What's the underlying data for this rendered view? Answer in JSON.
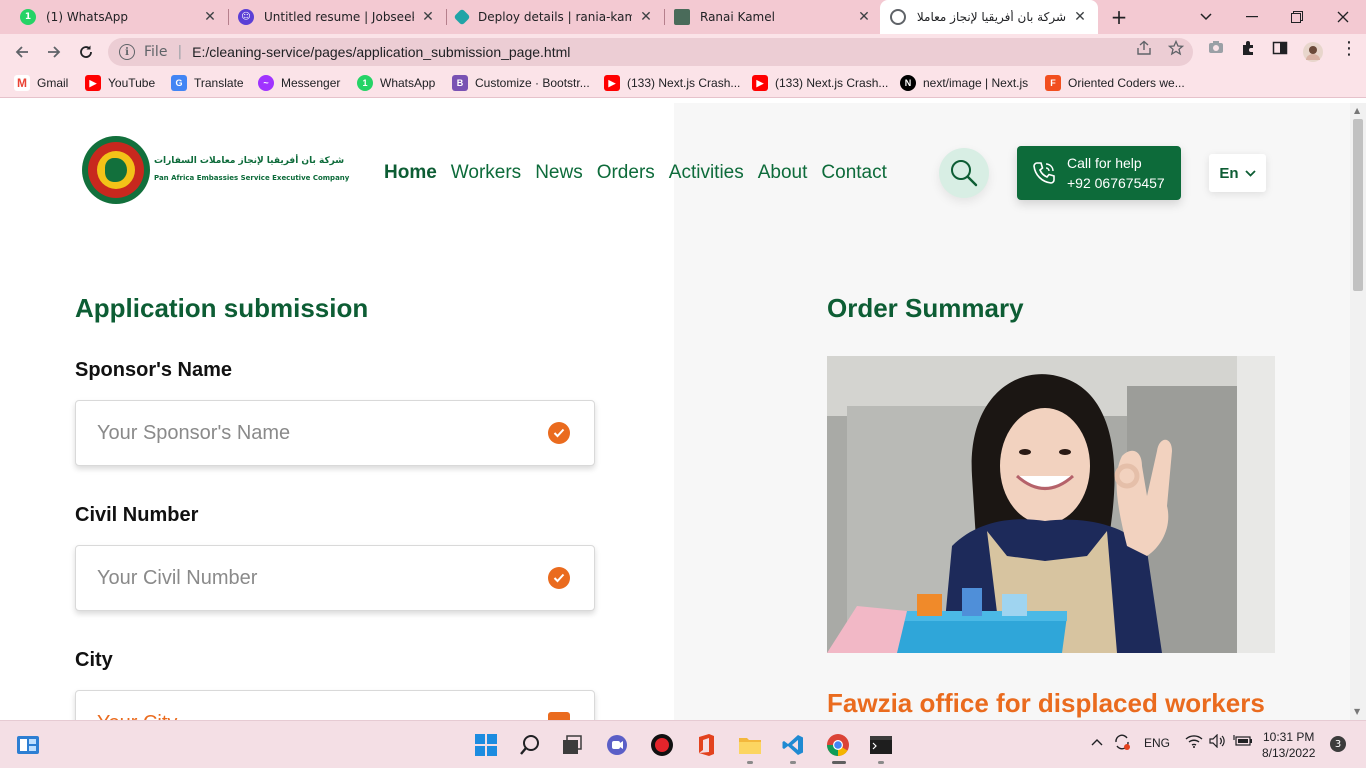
{
  "browser": {
    "tabs": [
      {
        "title": "(1) WhatsApp",
        "icon": "whatsapp-icon",
        "color": "#25d366"
      },
      {
        "title": "Untitled resume | Jobseeker",
        "icon": "jobseeker-icon",
        "color": "#5b3fd6"
      },
      {
        "title": "Deploy details | rania-kamel-",
        "icon": "netlify-icon",
        "color": "#20a4a7"
      },
      {
        "title": "Ranai Kamel",
        "icon": "portfolio-icon",
        "color": "#4a6b5a"
      },
      {
        "title": "شركة بان أفريقيا لإنجاز معاملات",
        "icon": "globe-icon",
        "color": "#5f6368"
      }
    ],
    "new_tab_symbol": "+",
    "close_symbol": "✕",
    "url_scheme": "File",
    "url": "E:/cleaning-service/pages/application_submission_page.html",
    "bookmarks": [
      {
        "label": "Gmail",
        "icon": "gmail-icon",
        "color": "#ea4335"
      },
      {
        "label": "YouTube",
        "icon": "youtube-icon",
        "color": "#ff0000"
      },
      {
        "label": "Translate",
        "icon": "translate-icon",
        "color": "#4285f4"
      },
      {
        "label": "Messenger",
        "icon": "messenger-icon",
        "color": "#a033ff"
      },
      {
        "label": "WhatsApp",
        "icon": "whatsapp-icon",
        "color": "#25d366"
      },
      {
        "label": "Customize · Bootstr...",
        "icon": "bootstrap-icon",
        "color": "#7952b3"
      },
      {
        "label": "(133) Next.js Crash...",
        "icon": "youtube-icon",
        "color": "#ff0000"
      },
      {
        "label": "(133) Next.js Crash...",
        "icon": "youtube-icon",
        "color": "#ff0000"
      },
      {
        "label": "next/image | Next.js",
        "icon": "nextjs-icon",
        "color": "#000000"
      },
      {
        "label": "Oriented Coders we...",
        "icon": "figma-icon",
        "color": "#f24e1e"
      }
    ]
  },
  "site": {
    "logo": {
      "arabic": "شركة بان أفريقيا لإنجاز معاملات السفارات",
      "english": "Pan Africa Embassies Service Executive Company"
    },
    "nav": [
      "Home",
      "Workers",
      "News",
      "Orders",
      "Activities",
      "About",
      "Contact"
    ],
    "call": {
      "line1": "Call for help",
      "line2": "+92 067675457"
    },
    "lang": "En",
    "colors": {
      "primary": "#0d6b3a",
      "accent": "#ea6b1e"
    }
  },
  "form": {
    "title": "Application submission",
    "fields": [
      {
        "label": "Sponsor's Name",
        "placeholder": "Your Sponsor's Name"
      },
      {
        "label": "Civil Number",
        "placeholder": "Your Civil Number"
      },
      {
        "label": "City",
        "placeholder": "Your City"
      }
    ]
  },
  "summary": {
    "title": "Order Summary",
    "office": "Fawzia office for displaced workers"
  },
  "taskbar": {
    "lang": "ENG",
    "time": "10:31 PM",
    "date": "8/13/2022",
    "notifications": "3"
  }
}
